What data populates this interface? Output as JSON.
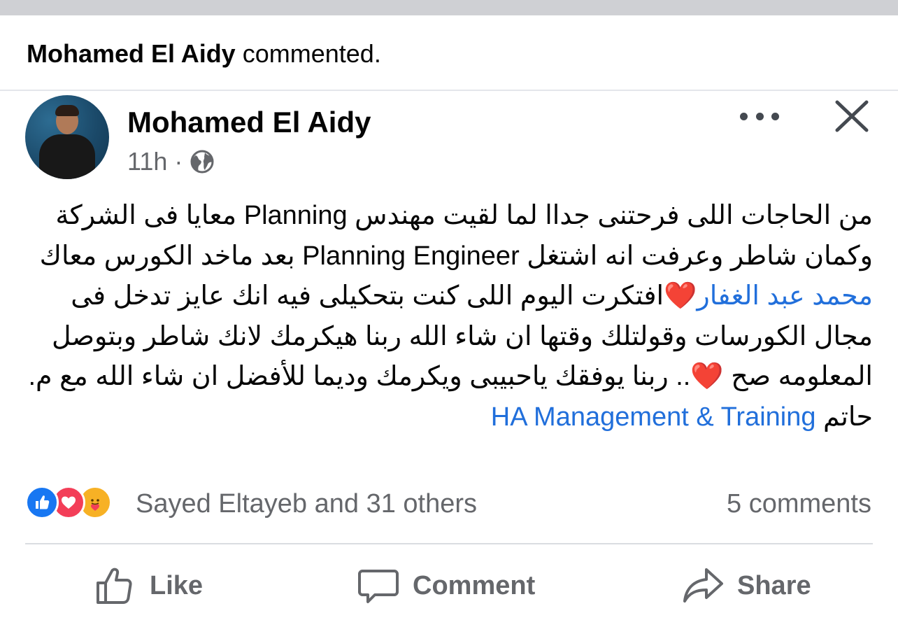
{
  "activity": {
    "actor": "Mohamed El Aidy",
    "action": "commented."
  },
  "post": {
    "author": "Mohamed El Aidy",
    "time": "11h",
    "separator": "·",
    "privacy_icon": "globe-icon",
    "text": {
      "part1": "من الحاجات اللى فرحتنى جداا لما لقيت مهندس Planning  معايا فى الشركة وكمان شاطر وعرفت انه اشتغل Planning Engineer بعد ماخد الكورس معاك ",
      "mention": "محمد عبد الغفار",
      "heart1": "❤️",
      "part2": "افتكرت اليوم اللى كنت بتحكيلى فيه انك عايز تدخل فى مجال الكورسات وقولتلك وقتها ان شاء الله ربنا هيكرمك لانك شاطر وبتوصل المعلومه صح ",
      "heart2": "❤️",
      "part3": ".. ربنا يوفقك ياحبيبى ويكرمك وديما للأفضل ان شاء الله مع م. حاتم ",
      "page_link": "HA Management & Training"
    }
  },
  "reactions": {
    "icons": [
      "like-icon",
      "love-icon",
      "care-icon"
    ],
    "summary": "Sayed Eltayeb and 31 others",
    "comments": "5 comments"
  },
  "actions": {
    "like": "Like",
    "comment": "Comment",
    "share": "Share"
  },
  "colors": {
    "link": "#216fdb",
    "like_blue": "#1877f2",
    "love_red": "#f33e58",
    "care_yellow": "#f7b125",
    "muted": "#65676b"
  }
}
